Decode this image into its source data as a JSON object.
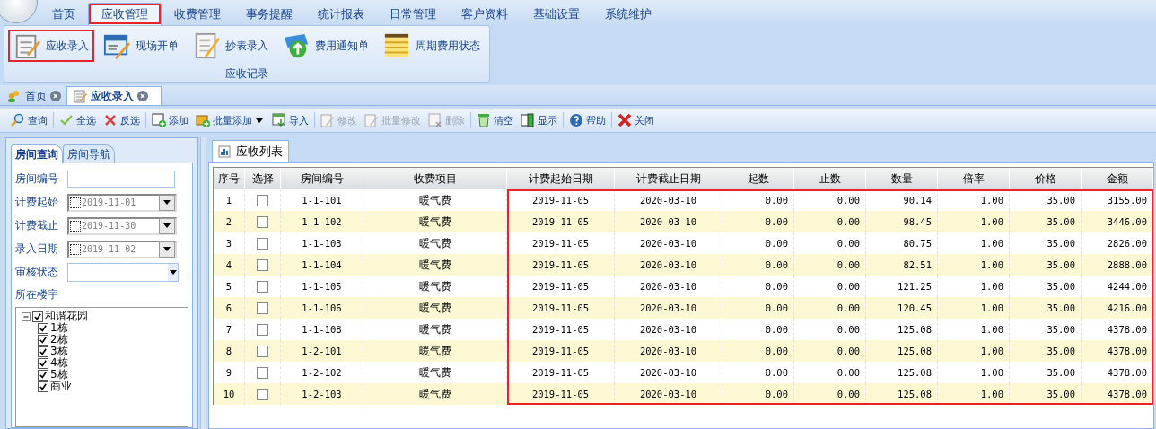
{
  "menu": [
    {
      "label": "首页",
      "selected": false,
      "highlighted": false
    },
    {
      "label": "应收管理",
      "selected": true,
      "highlighted": true
    },
    {
      "label": "收费管理",
      "selected": false,
      "highlighted": false
    },
    {
      "label": "事务提醒",
      "selected": false,
      "highlighted": false
    },
    {
      "label": "统计报表",
      "selected": false,
      "highlighted": false
    },
    {
      "label": "日常管理",
      "selected": false,
      "highlighted": false
    },
    {
      "label": "客户资料",
      "selected": false,
      "highlighted": false
    },
    {
      "label": "基础设置",
      "selected": false,
      "highlighted": false
    },
    {
      "label": "系统维护",
      "selected": false,
      "highlighted": false
    }
  ],
  "ribbon": {
    "group_label": "应收记录",
    "buttons": [
      {
        "label": "应收录入",
        "kind": "notepad",
        "highlighted": true
      },
      {
        "label": "现场开单",
        "kind": "form",
        "highlighted": false
      },
      {
        "label": "抄表录入",
        "kind": "list",
        "highlighted": false
      },
      {
        "label": "费用通知单",
        "kind": "upload",
        "highlighted": false
      },
      {
        "label": "周期费用状态",
        "kind": "sheet",
        "highlighted": false
      }
    ]
  },
  "doc_tabs": [
    {
      "label": "首页",
      "kind": "home",
      "selected": false
    },
    {
      "label": "应收录入",
      "kind": "notepad",
      "selected": true
    }
  ],
  "toolbar": [
    {
      "label": "查询",
      "kind": "search",
      "disabled": false,
      "separator_after": true
    },
    {
      "label": "全选",
      "kind": "check",
      "disabled": false,
      "separator_after": false
    },
    {
      "label": "反选",
      "kind": "cross",
      "disabled": false,
      "separator_after": true
    },
    {
      "label": "添加",
      "kind": "add",
      "disabled": false,
      "separator_after": false
    },
    {
      "label": "批量添加",
      "kind": "batch",
      "disabled": false,
      "separator_after": false,
      "dropdown": true
    },
    {
      "label": "导入",
      "kind": "import",
      "disabled": false,
      "separator_after": true
    },
    {
      "label": "修改",
      "kind": "edit",
      "disabled": true,
      "separator_after": false
    },
    {
      "label": "批量修改",
      "kind": "edit",
      "disabled": true,
      "separator_after": false
    },
    {
      "label": "删除",
      "kind": "delete",
      "disabled": true,
      "separator_after": true
    },
    {
      "label": "清空",
      "kind": "clear",
      "disabled": false,
      "separator_after": false
    },
    {
      "label": "显示",
      "kind": "display",
      "disabled": false,
      "separator_after": true
    },
    {
      "label": "帮助",
      "kind": "help",
      "disabled": false,
      "separator_after": true
    },
    {
      "label": "关闭",
      "kind": "close",
      "disabled": false,
      "separator_after": false
    }
  ],
  "query_panel": {
    "tabs": [
      {
        "label": "房间查询",
        "selected": true
      },
      {
        "label": "房间导航",
        "selected": false
      }
    ],
    "fields": [
      {
        "label": "房间编号",
        "kind": "text"
      },
      {
        "label": "计费起始",
        "kind": "date",
        "value": "2019-11-01",
        "checked": false
      },
      {
        "label": "计费截止",
        "kind": "date",
        "value": "2019-11-30",
        "checked": false
      },
      {
        "label": "录入日期",
        "kind": "date",
        "value": "2019-11-02",
        "checked": false
      },
      {
        "label": "审核状态",
        "kind": "select"
      }
    ],
    "tree_label": "所在楼宇",
    "tree": [
      {
        "label": "和谐花园",
        "checked": true,
        "expanded": true,
        "children": [
          {
            "label": "1栋",
            "checked": true
          },
          {
            "label": "2栋",
            "checked": true
          },
          {
            "label": "3栋",
            "checked": true
          },
          {
            "label": "4栋",
            "checked": true
          },
          {
            "label": "5栋",
            "checked": true
          },
          {
            "label": "商业",
            "checked": true
          }
        ]
      }
    ]
  },
  "list_tab": {
    "label": "应收列表"
  },
  "table": {
    "columns": [
      {
        "label": "序号",
        "annotated": false
      },
      {
        "label": "选择",
        "annotated": false
      },
      {
        "label": "房间编号",
        "annotated": false
      },
      {
        "label": "收费项目",
        "annotated": false
      },
      {
        "label": "计费起始日期",
        "annotated": true
      },
      {
        "label": "计费截止日期",
        "annotated": true
      },
      {
        "label": "起数",
        "annotated": true
      },
      {
        "label": "止数",
        "annotated": true
      },
      {
        "label": "数量",
        "annotated": true
      },
      {
        "label": "倍率",
        "annotated": true
      },
      {
        "label": "价格",
        "annotated": true
      },
      {
        "label": "金额",
        "annotated": true
      }
    ],
    "rows": [
      {
        "no": "1",
        "checked": false,
        "room": "1-1-101",
        "item": "暖气费",
        "start": "2019-11-05",
        "end": "2020-03-10",
        "from": "0.00",
        "to": "0.00",
        "qty": "90.14",
        "rate": "1.00",
        "price": "35.00",
        "amount": "3155.00"
      },
      {
        "no": "2",
        "checked": false,
        "room": "1-1-102",
        "item": "暖气费",
        "start": "2019-11-05",
        "end": "2020-03-10",
        "from": "0.00",
        "to": "0.00",
        "qty": "98.45",
        "rate": "1.00",
        "price": "35.00",
        "amount": "3446.00"
      },
      {
        "no": "3",
        "checked": false,
        "room": "1-1-103",
        "item": "暖气费",
        "start": "2019-11-05",
        "end": "2020-03-10",
        "from": "0.00",
        "to": "0.00",
        "qty": "80.75",
        "rate": "1.00",
        "price": "35.00",
        "amount": "2826.00"
      },
      {
        "no": "4",
        "checked": false,
        "room": "1-1-104",
        "item": "暖气费",
        "start": "2019-11-05",
        "end": "2020-03-10",
        "from": "0.00",
        "to": "0.00",
        "qty": "82.51",
        "rate": "1.00",
        "price": "35.00",
        "amount": "2888.00"
      },
      {
        "no": "5",
        "checked": false,
        "room": "1-1-105",
        "item": "暖气费",
        "start": "2019-11-05",
        "end": "2020-03-10",
        "from": "0.00",
        "to": "0.00",
        "qty": "121.25",
        "rate": "1.00",
        "price": "35.00",
        "amount": "4244.00"
      },
      {
        "no": "6",
        "checked": false,
        "room": "1-1-106",
        "item": "暖气费",
        "start": "2019-11-05",
        "end": "2020-03-10",
        "from": "0.00",
        "to": "0.00",
        "qty": "120.45",
        "rate": "1.00",
        "price": "35.00",
        "amount": "4216.00"
      },
      {
        "no": "7",
        "checked": false,
        "room": "1-1-108",
        "item": "暖气费",
        "start": "2019-11-05",
        "end": "2020-03-10",
        "from": "0.00",
        "to": "0.00",
        "qty": "125.08",
        "rate": "1.00",
        "price": "35.00",
        "amount": "4378.00"
      },
      {
        "no": "8",
        "checked": false,
        "room": "1-2-101",
        "item": "暖气费",
        "start": "2019-11-05",
        "end": "2020-03-10",
        "from": "0.00",
        "to": "0.00",
        "qty": "125.08",
        "rate": "1.00",
        "price": "35.00",
        "amount": "4378.00"
      },
      {
        "no": "9",
        "checked": false,
        "room": "1-2-102",
        "item": "暖气费",
        "start": "2019-11-05",
        "end": "2020-03-10",
        "from": "0.00",
        "to": "0.00",
        "qty": "125.08",
        "rate": "1.00",
        "price": "35.00",
        "amount": "4378.00"
      },
      {
        "no": "10",
        "checked": false,
        "room": "1-2-103",
        "item": "暖气费",
        "start": "2019-11-05",
        "end": "2020-03-10",
        "from": "0.00",
        "to": "0.00",
        "qty": "125.08",
        "rate": "1.00",
        "price": "35.00",
        "amount": "4378.00"
      }
    ]
  }
}
